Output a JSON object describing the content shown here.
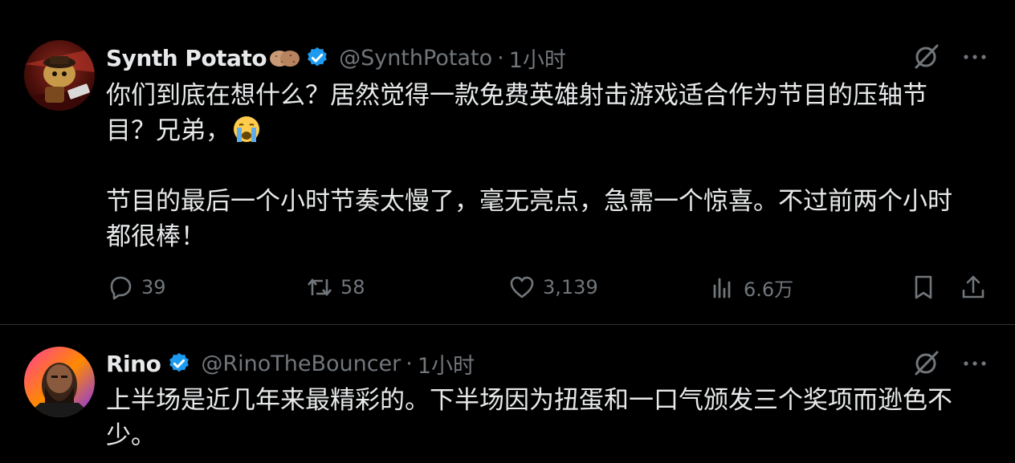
{
  "tweets": [
    {
      "display_name": "Synth Potato",
      "handle": "@SynthPotato",
      "separator": "·",
      "time": "1小时",
      "line1": "你们到底在想什么？居然觉得一款免费英雄射击游戏适合作为节目的压轴节",
      "line2": "目？兄弟，",
      "line3": "",
      "line4": "节目的最后一个小时节奏太慢了，毫无亮点，急需一个惊喜。不过前两个小时",
      "line5": "都很棒！",
      "stats": {
        "replies": "39",
        "retweets": "58",
        "likes": "3,139",
        "views": "6.6万"
      },
      "icons": [
        "grok-icon",
        "more-icon",
        "reply-icon",
        "retweet-icon",
        "like-icon",
        "views-icon",
        "bookmark-icon",
        "share-icon",
        "verified-badge-icon",
        "potato-emoji",
        "crying-face-emoji"
      ]
    },
    {
      "display_name": "Rino",
      "handle": "@RinoTheBouncer",
      "separator": "·",
      "time": "1小时",
      "line1": "上半场是近几年来最精彩的。下半场因为扭蛋和一口气颁发三个奖项而逊色不",
      "line2": "少。"
    }
  ],
  "colors": {
    "background": "#000000",
    "text": "#e7e9ea",
    "secondary": "#71767b",
    "verified": "#1d9bf0",
    "divider": "#2f3336"
  }
}
